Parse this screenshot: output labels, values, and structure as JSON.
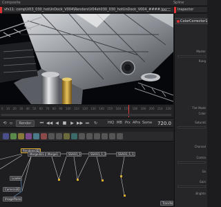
{
  "window": {
    "title": "Composite",
    "spline_label": "Spline"
  },
  "viewer": {
    "path": "vfx11: comp\\V03_030_hotUnDock_V004\\Renders\\V04sh030_030_hotUnDock_V004_####.jpg"
  },
  "timeline": {
    "ticks": [
      "0",
      "10",
      "20",
      "30",
      "40",
      "50",
      "60",
      "70",
      "80",
      "90",
      "100",
      "110",
      "120",
      "130",
      "140",
      "150",
      "160",
      "170",
      "180",
      "190",
      "200",
      "210",
      "220"
    ]
  },
  "transport": {
    "render_label": "Render",
    "buttons": [
      "⏮",
      "◀◀",
      "◀",
      "■",
      "▶",
      "▶▶",
      "⏭",
      "↻"
    ],
    "hq_label": "HiQ",
    "mb_label": "MB",
    "prx_label": "Prx",
    "aprx_label": "APrx",
    "some_label": "Some",
    "current_frame": "720.0"
  },
  "node_editor": {
    "nodes": [
      {
        "id": "n1",
        "label": "Renderer3D1",
        "sel": true
      },
      {
        "id": "n2",
        "label": "Merge3D1",
        "sel": false
      },
      {
        "id": "n3",
        "label": "Merge1",
        "sel": false
      },
      {
        "id": "n4",
        "label": "SSAO1_1_1",
        "sel": false
      },
      {
        "id": "n5",
        "label": "SSAO1_1_2",
        "sel": false
      },
      {
        "id": "n6",
        "label": "SSAO1_1_1_1",
        "sel": false
      },
      {
        "id": "n7",
        "label": "Camera3D1",
        "sel": false
      },
      {
        "id": "n8",
        "label": "ImagePlane3D1",
        "sel": false
      },
      {
        "id": "n9",
        "label": "Loader1",
        "sel": false
      },
      {
        "id": "n10",
        "label": "Transform1",
        "sel": false
      }
    ]
  },
  "inspector": {
    "title": "Inspector",
    "tool_name": "ColorCorrector1",
    "labels": [
      "Master",
      "Rang",
      "Tint Mode",
      "Color",
      "Saturati",
      "Channel",
      "Contra",
      "Ga",
      "Gain",
      "Brightn"
    ]
  },
  "colors": {
    "accent": "#dd3333",
    "panel": "#2a2a2d",
    "background": "#1c1c1e",
    "selected": "#e0b030"
  }
}
